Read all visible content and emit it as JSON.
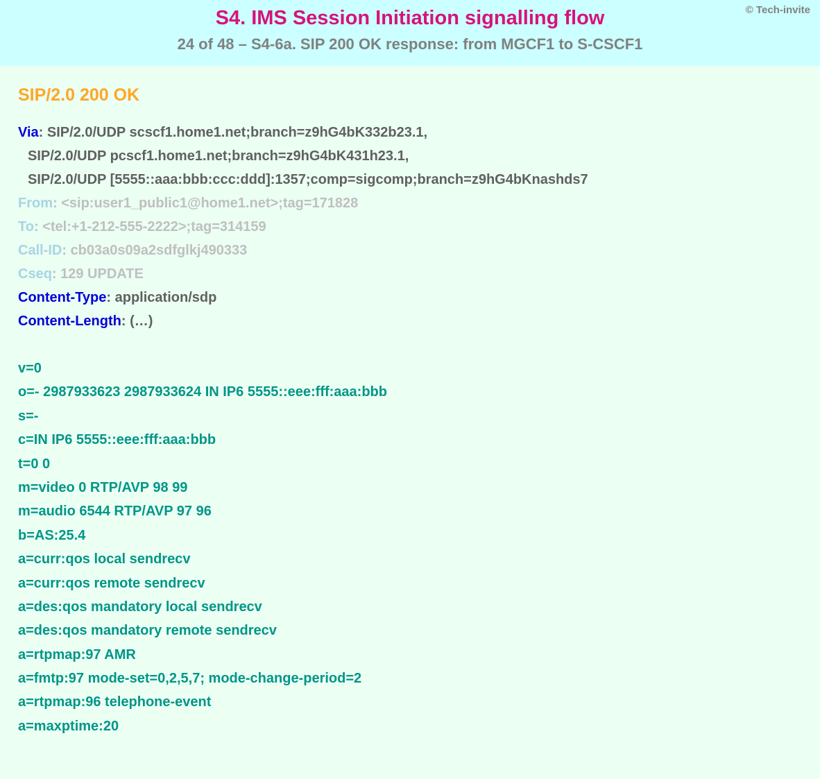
{
  "copyright": "© Tech-invite",
  "title": "S4. IMS Session Initiation signalling flow",
  "subtitle": "24 of 48 – S4-6a. SIP 200 OK response: from MGCF1 to S-CSCF1",
  "status_line": "SIP/2.0 200 OK",
  "headers": {
    "via": {
      "name": "Via",
      "lines": [
        "SIP/2.0/UDP scscf1.home1.net;branch=z9hG4bK332b23.1,",
        "SIP/2.0/UDP pcscf1.home1.net;branch=z9hG4bK431h23.1,",
        "SIP/2.0/UDP [5555::aaa:bbb:ccc:ddd]:1357;comp=sigcomp;branch=z9hG4bKnashds7"
      ]
    },
    "from": {
      "name": "From",
      "value": "<sip:user1_public1@home1.net>;tag=171828"
    },
    "to": {
      "name": "To",
      "value": "<tel:+1-212-555-2222>;tag=314159"
    },
    "callid": {
      "name": "Call-ID",
      "value": "cb03a0s09a2sdfglkj490333"
    },
    "cseq": {
      "name": "Cseq",
      "value": "129 UPDATE"
    },
    "ctype": {
      "name": "Content-Type",
      "value": "application/sdp"
    },
    "clen": {
      "name": "Content-Length",
      "value": "(…)"
    }
  },
  "sdp": [
    "v=0",
    "o=- 2987933623 2987933624 IN IP6 5555::eee:fff:aaa:bbb",
    "s=-",
    "c=IN IP6 5555::eee:fff:aaa:bbb",
    "t=0 0",
    "m=video 0 RTP/AVP 98 99",
    "m=audio 6544 RTP/AVP 97 96",
    "b=AS:25.4",
    "a=curr:qos local sendrecv",
    "a=curr:qos remote sendrecv",
    "a=des:qos mandatory local sendrecv",
    "a=des:qos mandatory remote sendrecv",
    "a=rtpmap:97 AMR",
    "a=fmtp:97 mode-set=0,2,5,7; mode-change-period=2",
    "a=rtpmap:96 telephone-event",
    "a=maxptime:20"
  ]
}
